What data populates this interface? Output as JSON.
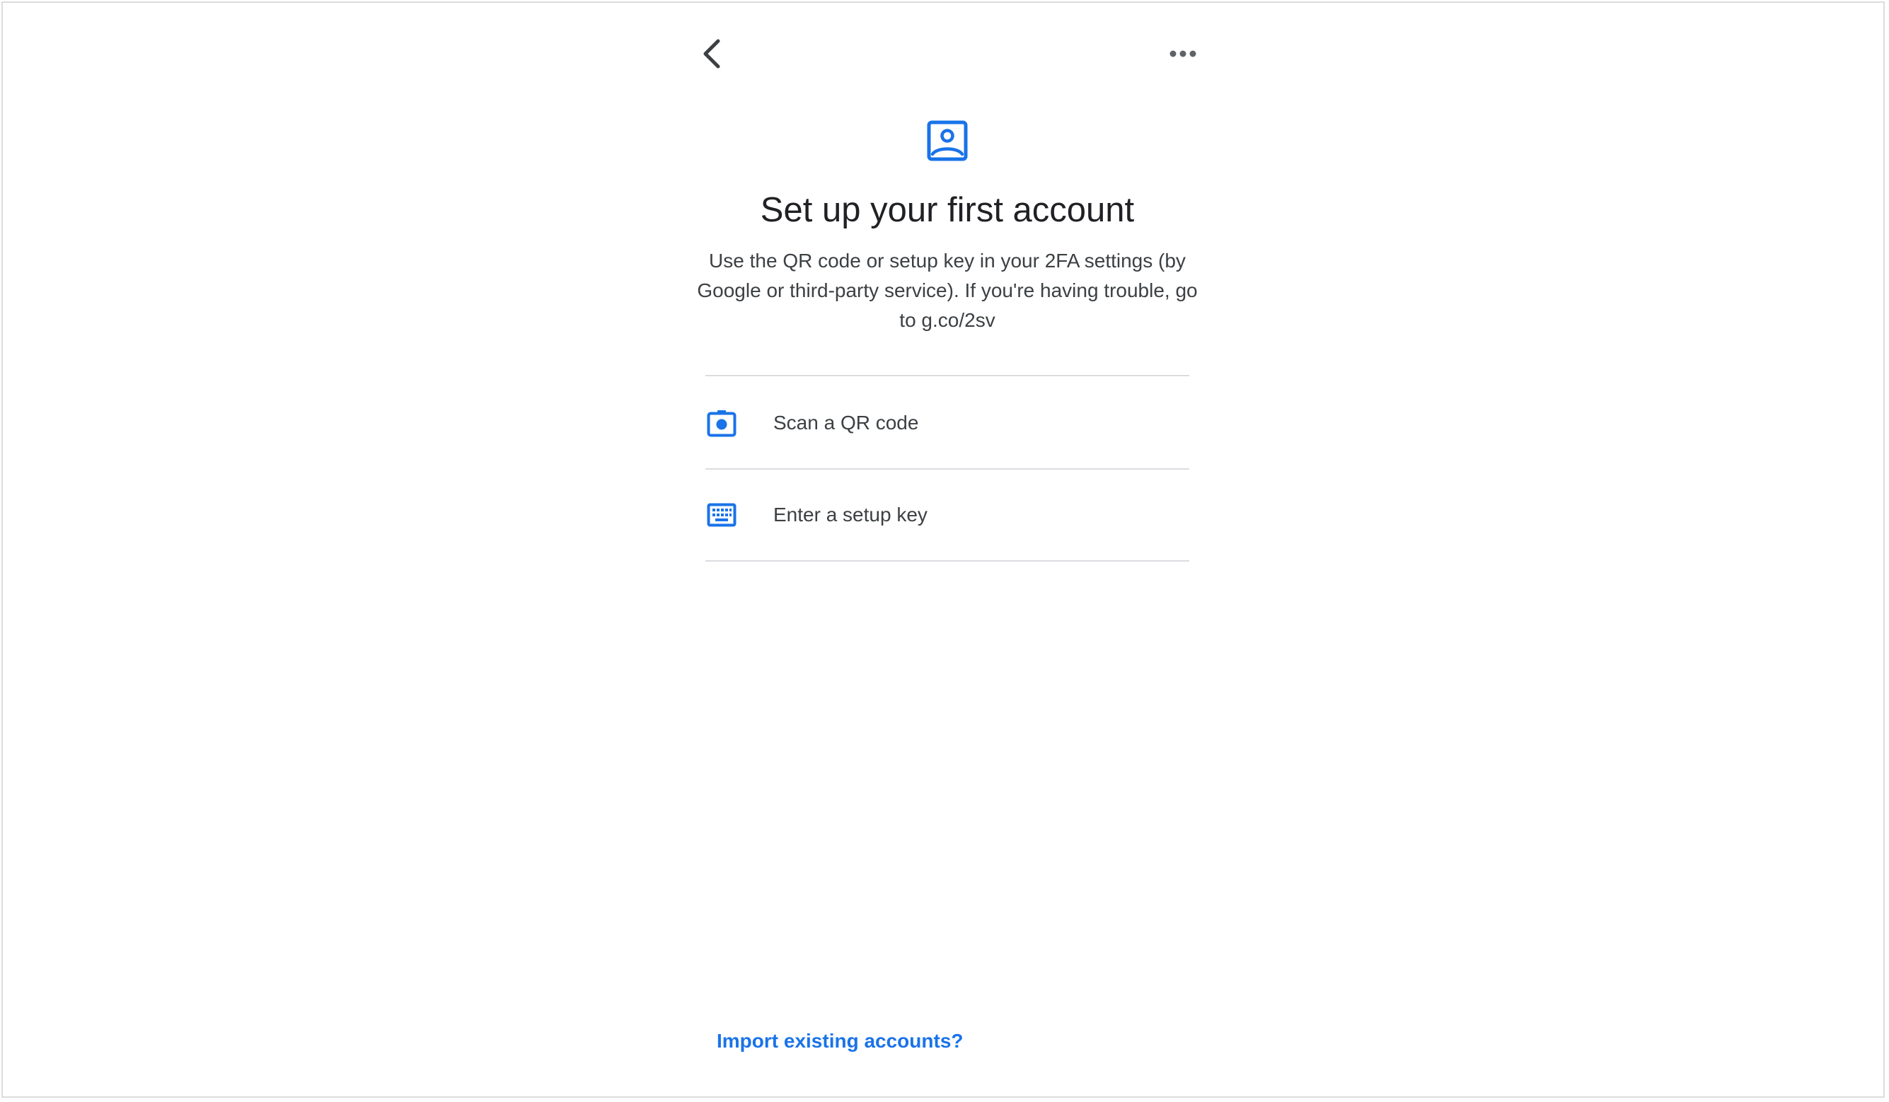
{
  "header": {
    "back_icon": "chevron-left-icon",
    "more_icon": "more-horizontal-icon"
  },
  "hero": {
    "icon": "account-box-icon",
    "title": "Set up your first account",
    "description": "Use the QR code or setup key in your 2FA settings (by Google or third-party service). If you're having trouble, go to g.co/2sv"
  },
  "options": [
    {
      "icon": "camera-icon",
      "label": "Scan a QR code"
    },
    {
      "icon": "keyboard-icon",
      "label": "Enter a setup key"
    }
  ],
  "footer": {
    "import_label": "Import existing accounts?"
  },
  "colors": {
    "accent": "#1a73e8",
    "text_primary": "#202124",
    "text_secondary": "#3c4043",
    "divider": "#dadce0"
  }
}
